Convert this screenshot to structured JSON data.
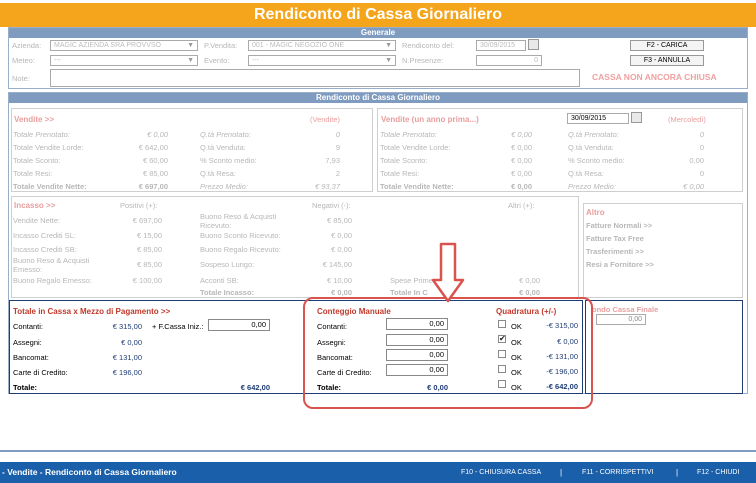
{
  "title": "Rendiconto di Cassa Giornaliero",
  "generale": {
    "header": "Generale",
    "azienda_label": "Azienda:",
    "azienda_value": "MAGIC AZIENDA SRA PROVVSO",
    "pvendita_label": "P.Vendita:",
    "pvendita_value": "001 - MAGIC NEGOZIO ONE",
    "rendiconto_del_label": "Rendiconto del:",
    "rendiconto_del_value": "30/09/2015",
    "meteo_label": "Meteo:",
    "meteo_value": "---",
    "evento_label": "Evento:",
    "evento_value": "---",
    "npresenze_label": "N.Presenze:",
    "npresenze_value": "0",
    "note_label": "Note:",
    "carica_button": "F2 - CARICA",
    "annulla_button": "F3 - ANNULLA",
    "status_text": "CASSA NON ANCORA CHIUSA"
  },
  "rendiconto": {
    "header": "Rendiconto di Cassa Giornaliero",
    "vendite": {
      "title": "Vendite >>",
      "tag": "(Vendite)",
      "rows": [
        {
          "label": "Totale Prenotato:",
          "value": "€ 0,00",
          "qlabel": "Q.tà Prenotato:",
          "qvalue": "0"
        },
        {
          "label": "Totale Vendite Lorde:",
          "value": "€ 642,00",
          "qlabel": "Q.tà Venduta:",
          "qvalue": "9"
        },
        {
          "label": "Totale Sconto:",
          "value": "€ 60,00",
          "qlabel": "% Sconto medio:",
          "qvalue": "7,93"
        },
        {
          "label": "Totale Resi:",
          "value": "€ 85,00",
          "qlabel": "Q.tà Resa:",
          "qvalue": "2"
        }
      ],
      "nette_label": "Totale Vendite Nette:",
      "nette_value": "€ 697,00",
      "prezzo_label": "Prezzo Medio:",
      "prezzo_value": "€ 93,37"
    },
    "anno_prima": {
      "title": "Vendite (un anno prima...)",
      "date": "30/09/2015",
      "tag": "(Mercoledì)",
      "rows": [
        {
          "label": "Totale Prenotato:",
          "value": "€ 0,00",
          "qlabel": "Q.tà Prenotato:",
          "qvalue": "0"
        },
        {
          "label": "Totale Vendite Lorde:",
          "value": "€ 0,00",
          "qlabel": "Q.tà Venduta:",
          "qvalue": "0"
        },
        {
          "label": "Totale Sconto:",
          "value": "€ 0,00",
          "qlabel": "% Sconto medio:",
          "qvalue": "0,00"
        },
        {
          "label": "Totale Resi:",
          "value": "€ 0,00",
          "qlabel": "Q.tà Resa:",
          "qvalue": "0"
        }
      ],
      "nette_label": "Totale Vendite Nette:",
      "nette_value": "€ 0,00",
      "prezzo_label": "Prezzo Medio:",
      "prezzo_value": "€ 0,00"
    },
    "incasso": {
      "title": "Incasso >>",
      "positivi": "Positivi (+):",
      "negativi": "Negativi (-):",
      "altri": "Altri (+):",
      "left_rows": [
        {
          "label": "Vendite Nette:",
          "value": "€ 697,00"
        },
        {
          "label": "Incasso Crediti SL:",
          "value": "€ 15,00"
        },
        {
          "label": "Incasso Crediti SB:",
          "value": "€ 85,00"
        },
        {
          "label": "Buono Reso & Acquisti Emesso:",
          "value": "€ 85,00"
        },
        {
          "label": "Buono Regalo Emesso:",
          "value": "€ 100,00"
        }
      ],
      "mid_rows": [
        {
          "label": "Buono Reso & Acquisti Ricevuto:",
          "value": "€ 85,00"
        },
        {
          "label": "Buono Sconto Ricevuto:",
          "value": "€ 0,00"
        },
        {
          "label": "Buono Regalo Ricevuto:",
          "value": "€ 0,00"
        },
        {
          "label": "Sospeso Lungo:",
          "value": "€ 145,00"
        },
        {
          "label": "Acconti SB:",
          "value": "€ 10,00"
        }
      ],
      "spese_label": "Spese Prime",
      "spese_value": "€ 0,00",
      "totale_incasso_label": "Totale Incasso:",
      "totale_incasso_value": "€ 0,00",
      "totale_in_label": "Totale In C",
      "totale_in_value": "€ 0,00"
    },
    "altro": {
      "title": "Altro",
      "items": [
        "Fatture Normali >>",
        "Fatture Tax Free",
        "Trasferimenti >>",
        "Resi a Fornitore >>"
      ]
    }
  },
  "totale_cassa": {
    "title": "Totale in Cassa x Mezzo di Pagamento >>",
    "rows": [
      {
        "label": "Contanti:",
        "value": "€ 315,00"
      },
      {
        "label": "Assegni:",
        "value": "€ 0,00"
      },
      {
        "label": "Bancomat:",
        "value": "€ 131,00"
      },
      {
        "label": "Carte di Credito:",
        "value": "€ 196,00"
      }
    ],
    "fcassa_label": "+ F.Cassa Iniz.:",
    "fcassa_value": "0,00",
    "totale_label": "Totale:",
    "totale_value": "€ 642,00"
  },
  "conteggio": {
    "title": "Conteggio Manuale",
    "rows": [
      {
        "label": "Contanti:",
        "value": "0,00"
      },
      {
        "label": "Assegni:",
        "value": "0,00"
      },
      {
        "label": "Bancomat:",
        "value": "0,00"
      },
      {
        "label": "Carte di Credito:",
        "value": "0,00"
      }
    ],
    "totale_label": "Totale:",
    "totale_value": "€ 0,00"
  },
  "quadratura": {
    "title": "Quadratura (+/-)",
    "ok_label": "OK",
    "rows": [
      {
        "value": "-€ 315,00",
        "checked": false
      },
      {
        "value": "€ 0,00",
        "checked": true
      },
      {
        "value": "-€ 131,00",
        "checked": false
      },
      {
        "value": "-€ 196,00",
        "checked": false
      }
    ],
    "totale_value": "-€ 642,00"
  },
  "fondo_cassa": {
    "title": "ondo Cassa Finale",
    "value": "0,00"
  },
  "status_bar": {
    "title": "- Vendite - Rendiconto di Cassa Giornaliero",
    "f10": "F10 - CHIUSURA CASSA",
    "f11": "F11 - CORRISPETTIVI",
    "f12": "F12 - CHIUDI"
  },
  "colors": {
    "title_bar": "#f5a51b",
    "section_header": "#7f9cc0",
    "status_bar": "#1a5faa",
    "highlight_red": "#d9534f"
  }
}
